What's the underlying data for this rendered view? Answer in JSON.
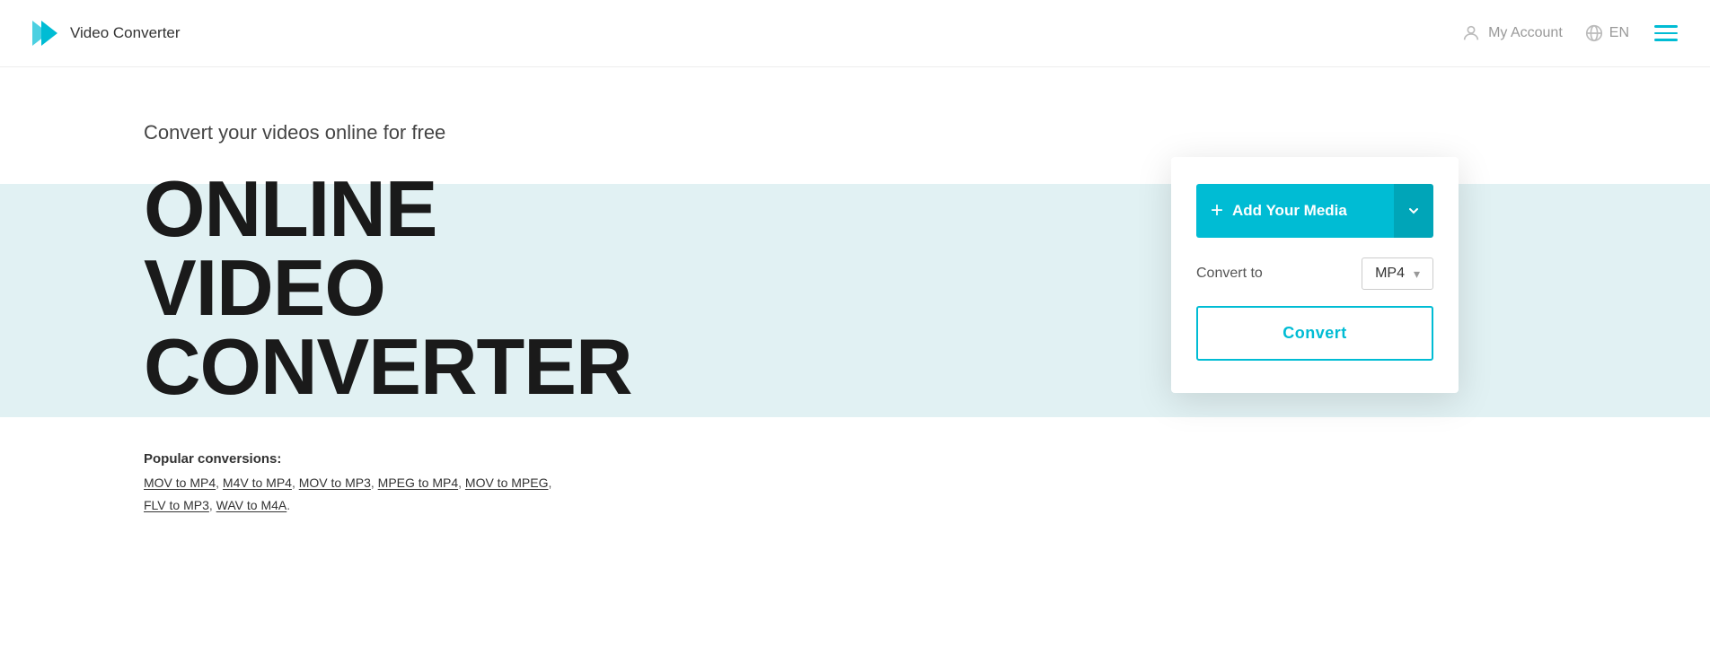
{
  "header": {
    "logo_text": "Video Converter",
    "my_account_label": "My Account",
    "lang_label": "EN",
    "logo_icon_color": "#00bcd4"
  },
  "hero": {
    "subtitle": "Convert your videos online for free",
    "title_line1": "ONLINE",
    "title_line2": "VIDEO",
    "title_line3": "CONVERTER",
    "popular_label": "Popular conversions:",
    "popular_links": [
      {
        "text": "MOV to MP4",
        "href": "#"
      },
      {
        "text": "M4V to MP4",
        "href": "#"
      },
      {
        "text": "MOV to MP3",
        "href": "#"
      },
      {
        "text": "MPEG to MP4",
        "href": "#"
      },
      {
        "text": "MOV to MPEG",
        "href": "#"
      },
      {
        "text": "FLV to MP3",
        "href": "#"
      },
      {
        "text": "WAV to M4A",
        "href": "#"
      }
    ]
  },
  "converter": {
    "add_media_label": "Add Your Media",
    "convert_to_label": "Convert to",
    "format_selected": "MP4",
    "convert_button_label": "Convert"
  }
}
